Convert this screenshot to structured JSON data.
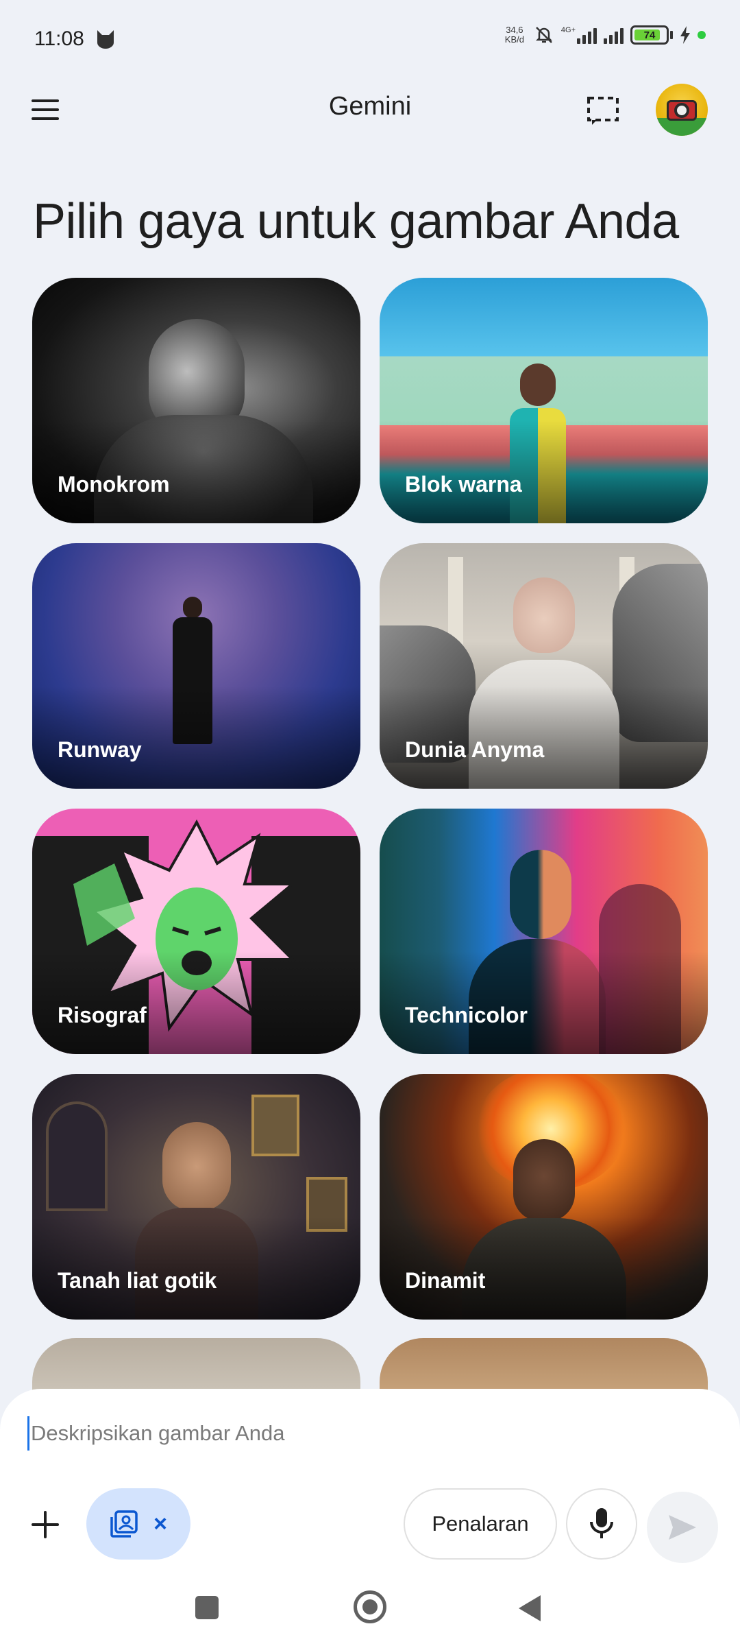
{
  "status_bar": {
    "time": "11:08",
    "net_speed_value": "34,6",
    "net_speed_unit": "KB/d",
    "network_type": "4G+",
    "battery": "74"
  },
  "app_bar": {
    "title": "Gemini",
    "menu_icon": "hamburger-menu-icon",
    "screenshot_icon": "screenshot-dashed-frame-icon"
  },
  "page": {
    "heading": "Pilih gaya untuk gambar Anda"
  },
  "styles": [
    {
      "label": "Monokrom"
    },
    {
      "label": "Blok warna"
    },
    {
      "label": "Runway"
    },
    {
      "label": "Dunia Anyma"
    },
    {
      "label": "Risograf"
    },
    {
      "label": "Technicolor"
    },
    {
      "label": "Tanah liat gotik"
    },
    {
      "label": "Dinamit"
    }
  ],
  "composer": {
    "placeholder": "Deskripsikan gambar Anda",
    "reasoning_label": "Penalaran",
    "image_chip_icon": "image-generation-icon",
    "close_symbol": "×"
  },
  "colors": {
    "accent": "#0b57d0",
    "chip_bg": "#d3e3fd",
    "background": "#eef1f7"
  }
}
